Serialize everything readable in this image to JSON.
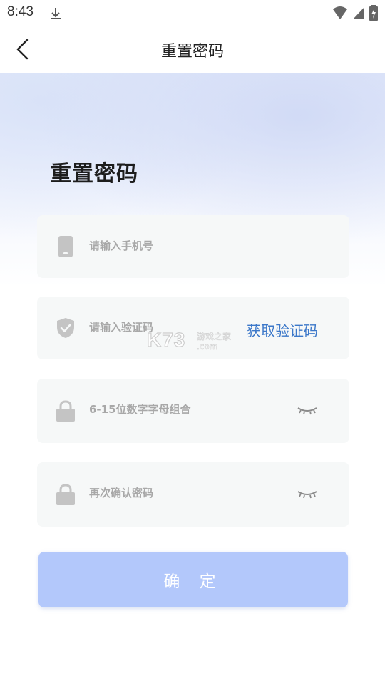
{
  "status_bar": {
    "time": "8:43",
    "icons": [
      "download-icon",
      "wifi-icon",
      "signal-icon",
      "battery-charging-icon"
    ]
  },
  "nav": {
    "title": "重置密码",
    "back_icon": "chevron-left-icon"
  },
  "page": {
    "heading": "重置密码"
  },
  "form": {
    "phone": {
      "placeholder": "请输入手机号",
      "icon": "phone-icon"
    },
    "code": {
      "placeholder": "请输入验证码",
      "icon": "shield-check-icon",
      "action_label": "获取验证码"
    },
    "password": {
      "placeholder": "6-15位数字字母组合",
      "icon": "lock-icon",
      "toggle_icon": "eye-closed-icon"
    },
    "confirm_password": {
      "placeholder": "再次确认密码",
      "icon": "lock-icon",
      "toggle_icon": "eye-closed-icon"
    },
    "submit_label": "确 定"
  },
  "watermark": {
    "logo": "K73",
    "sub_line1": "游戏之家",
    "sub_line2": ".com"
  },
  "colors": {
    "accent": "#3c78c9",
    "button": "#b3c8fb",
    "field_bg": "#f6f8f8",
    "icon": "#c4c4c4"
  }
}
